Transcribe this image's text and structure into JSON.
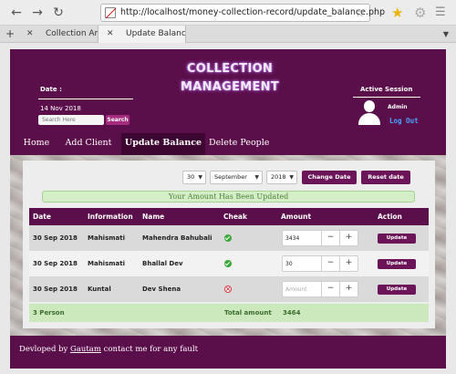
{
  "browser": {
    "url": "http://localhost/money-collection-record/update_balance.php",
    "tabs": [
      {
        "title": "Collection Amo..."
      },
      {
        "title": "Update Balance"
      }
    ]
  },
  "header": {
    "logo_text": "COLLECTION MANAGEMENT",
    "date_label": "Date :",
    "date_value": "14 Nov 2018",
    "search_placeholder": "Search Here",
    "search_button": "Search",
    "session_label": "Active Session",
    "admin_name": "Admin",
    "logout_label": "Log Out"
  },
  "nav": {
    "items": [
      {
        "label": "Home"
      },
      {
        "label": "Add Client"
      },
      {
        "label": "Update Balance"
      },
      {
        "label": "Delete People"
      }
    ],
    "active_index": 2
  },
  "filters": {
    "day": "30",
    "month": "September",
    "year": "2018",
    "change_button": "Change Date",
    "reset_button": "Reset date"
  },
  "alert": "Your Amount Has Been Updated",
  "table": {
    "headers": {
      "date": "Date",
      "information": "Information",
      "name": "Name",
      "cheak": "Cheak",
      "amount": "Amount",
      "action": "Action"
    },
    "rows": [
      {
        "date": "30 Sep 2018",
        "information": "Mahismati",
        "name": "Mahendra Bahubali",
        "status": "ok",
        "amount": "3434",
        "placeholder": "",
        "action": "Update"
      },
      {
        "date": "30 Sep 2018",
        "information": "Mahismati",
        "name": "Bhallal Dev",
        "status": "ok",
        "amount": "30",
        "placeholder": "",
        "action": "Update"
      },
      {
        "date": "30 Sep 2018",
        "information": "Kuntal",
        "name": "Dev Shena",
        "status": "bad",
        "amount": "",
        "placeholder": "Amount",
        "action": "Update"
      }
    ],
    "footer": {
      "count": "3 Person",
      "total_label": "Total amount",
      "total_value": "3464"
    },
    "stepper_minus": "−",
    "stepper_plus": "+"
  },
  "footer": {
    "prefix": "Devloped by",
    "author": "Gautam",
    "suffix": "contact me for any fault"
  },
  "colors": {
    "brand": "#5b0f4a",
    "button": "#6b1457",
    "success_bg": "#d4efc8",
    "link": "#4aa3ff"
  }
}
